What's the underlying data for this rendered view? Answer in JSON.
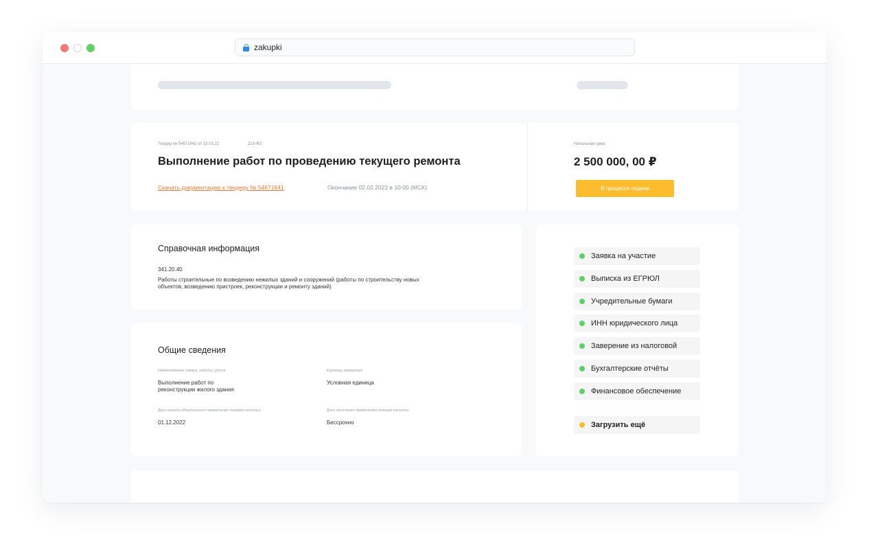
{
  "browser": {
    "url": "zakupki"
  },
  "tender": {
    "number_meta": "Тендер № 54671641 от 15.01.22",
    "law": "223-ФЗ",
    "title": "Выполнение работ по проведению текущего ремонта",
    "doc_link": "Скачать документацию к тендеру № 54671641",
    "deadline": "Окончание 02.02.2022 в 10:00 (МСК)",
    "price_label": "Начальная цена",
    "price": "2 500 000, 00 ₽",
    "status_button": "В процессе подачи"
  },
  "reference": {
    "title": "Справочная информация",
    "code": "341.20.40",
    "description": "Работы строительные по возведению нежилых зданий и сооружений (работы по строительству новых объектов, возведению пристроек, реконструкции и ремонту зданий)"
  },
  "general": {
    "title": "Общие сведения",
    "fields": [
      {
        "label": "Наименование товара, работы, услуги",
        "value": "Выполнение работ по реконструкции жилого здания"
      },
      {
        "label": "Единицы измерения",
        "value": "Условная единица"
      },
      {
        "label": "Дата начала обязательного применения позиции каталога",
        "value": "01.12.2022"
      },
      {
        "label": "Дата окончания применения позиции каталога",
        "value": "Бессрочно"
      }
    ]
  },
  "documents": {
    "items": [
      {
        "label": "Заявка на участие",
        "status": "done"
      },
      {
        "label": "Выписка из ЕГРЮЛ",
        "status": "done"
      },
      {
        "label": "Учредительные бумаги",
        "status": "done"
      },
      {
        "label": "ИНН юридического лица",
        "status": "done"
      },
      {
        "label": "Заверение из налоговой",
        "status": "done"
      },
      {
        "label": "Бухгалтерские отчёты",
        "status": "done"
      },
      {
        "label": "Финансовое обеспечение",
        "status": "done"
      }
    ],
    "load_more": "Загрузить ещё"
  },
  "colors": {
    "accent": "#fbbd2e",
    "link": "#e87934",
    "done": "#5fd067",
    "pending": "#fbbd2e"
  }
}
